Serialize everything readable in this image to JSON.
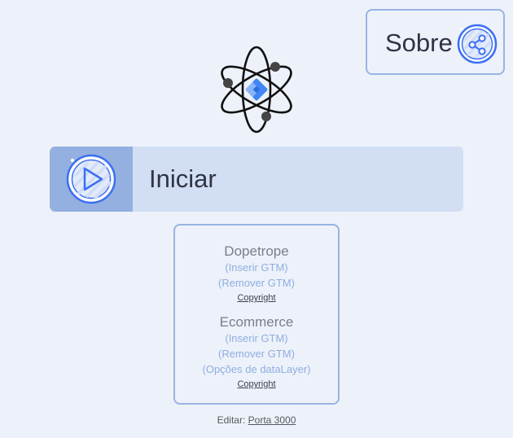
{
  "header": {
    "sobre_label": "Sobre",
    "sobre_icon": "share-icon"
  },
  "logo": {
    "icon": "atom-gtm-logo"
  },
  "start": {
    "label": "Iniciar",
    "icon": "play-icon"
  },
  "sections": [
    {
      "title": "Dopetrope",
      "links": [
        "(Inserir GTM)",
        "(Remover GTM)"
      ],
      "copyright": "Copyright"
    },
    {
      "title": "Ecommerce",
      "links": [
        "(Inserir GTM)",
        "(Remover GTM)",
        "(Opções de dataLayer)"
      ],
      "copyright": "Copyright"
    }
  ],
  "footer": {
    "prefix": "Editar:",
    "link": "Porta 3000"
  },
  "colors": {
    "background": "#edf1fa",
    "accent": "#3b6ff2",
    "border": "#97b4e3",
    "link": "#8eaee0"
  }
}
